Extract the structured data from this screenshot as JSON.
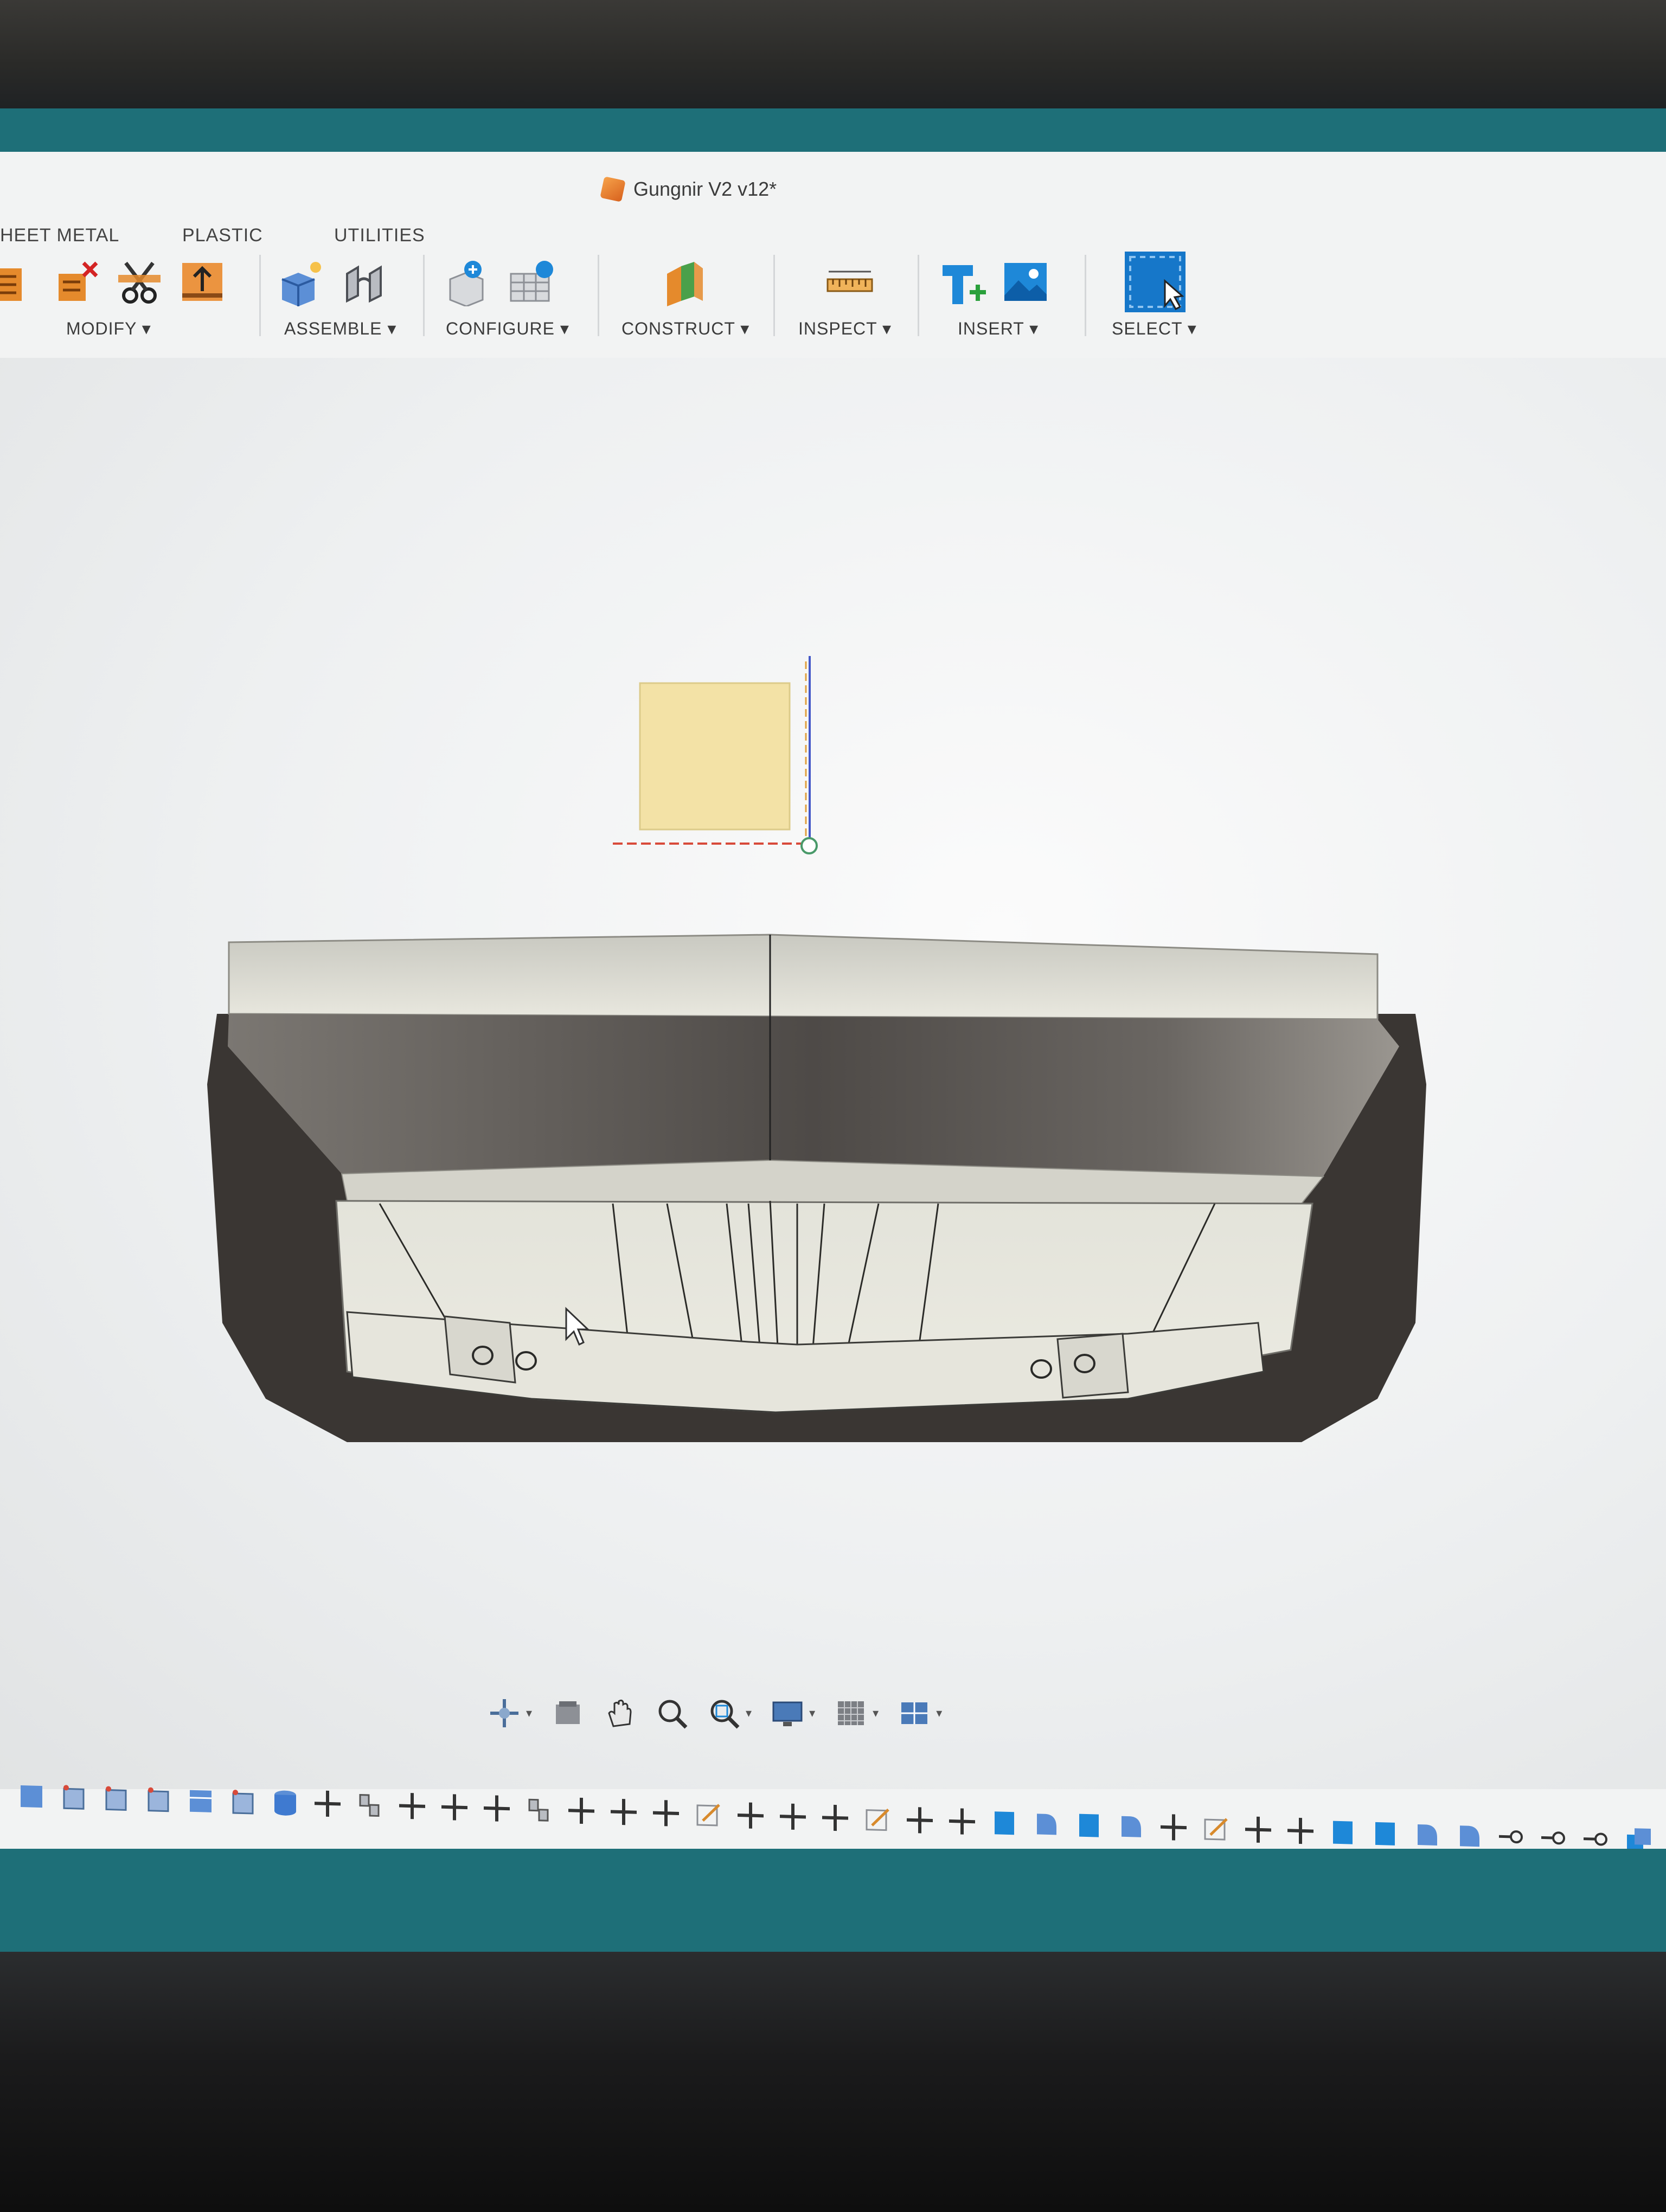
{
  "window": {
    "title": "Gungnir V2 v12*"
  },
  "tabs": [
    {
      "label": "HEET METAL"
    },
    {
      "label": "PLASTIC"
    },
    {
      "label": "UTILITIES"
    }
  ],
  "toolbar": {
    "modify": "MODIFY ▾",
    "assemble": "ASSEMBLE ▾",
    "configure": "CONFIGURE ▾",
    "construct": "CONSTRUCT ▾",
    "inspect": "INSPECT ▾",
    "insert": "INSERT ▾",
    "select": "SELECT ▾"
  },
  "colors": {
    "accent": "#1e88d8",
    "sketch_plane": "#f3e2a6",
    "body_light": "#e9e8df",
    "body_dark": "#5b5652",
    "taskbar": "#1c6a72"
  },
  "icons": {
    "doc": "orange-cube-icon",
    "taskbar": [
      "chrome-icon",
      "discord-icon",
      "resource-monitor-icon",
      "fusion-icon"
    ]
  }
}
